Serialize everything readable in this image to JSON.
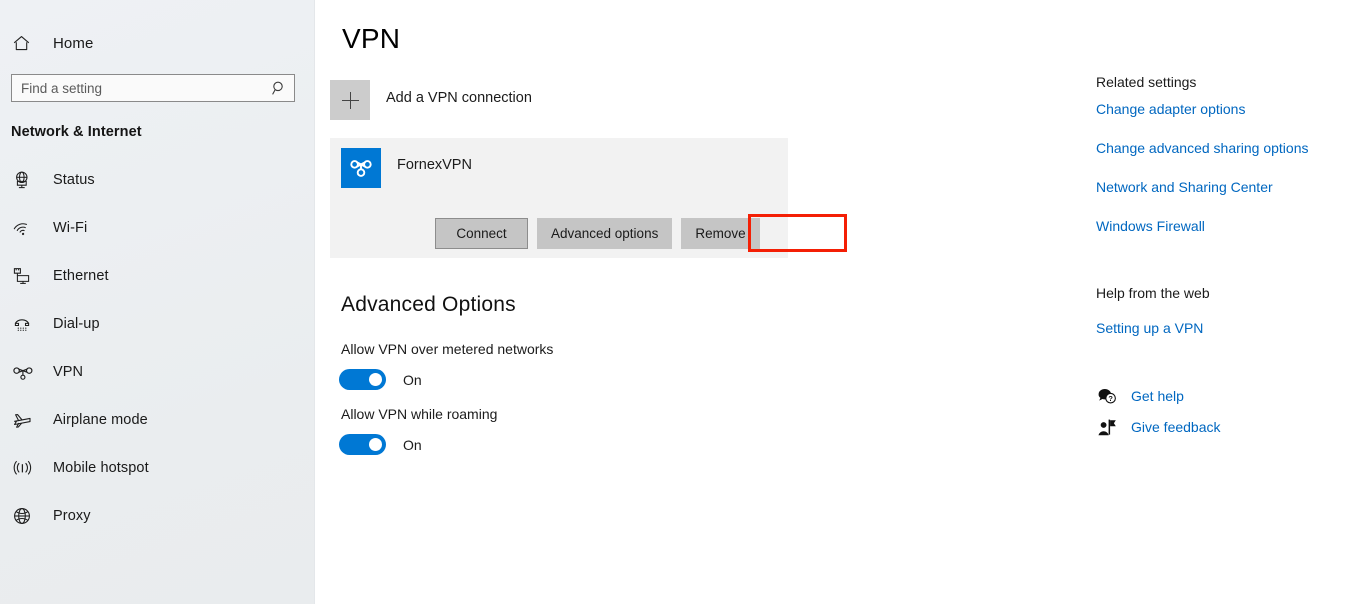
{
  "sidebar": {
    "home": {
      "label": "Home",
      "icon": "home-icon"
    },
    "search": {
      "value": "",
      "placeholder": "Find a setting",
      "icon": "search-icon"
    },
    "category": "Network & Internet",
    "items": [
      {
        "label": "Status",
        "icon": "globe-monitor-icon"
      },
      {
        "label": "Wi-Fi",
        "icon": "wifi-icon"
      },
      {
        "label": "Ethernet",
        "icon": "ethernet-icon"
      },
      {
        "label": "Dial-up",
        "icon": "dialup-phone-icon"
      },
      {
        "label": "VPN",
        "icon": "vpn-icon"
      },
      {
        "label": "Airplane mode",
        "icon": "airplane-icon"
      },
      {
        "label": "Mobile hotspot",
        "icon": "hotspot-icon"
      },
      {
        "label": "Proxy",
        "icon": "globe-icon"
      }
    ]
  },
  "main": {
    "title": "VPN",
    "add_connection": {
      "label": "Add a VPN connection",
      "icon": "plus-icon"
    },
    "connection": {
      "name": "FornexVPN",
      "icon": "vpn-knot-icon",
      "icon_color": "#0078d4",
      "buttons": [
        {
          "label": "Connect",
          "name": "connect-button",
          "highlighted": true
        },
        {
          "label": "Advanced options",
          "name": "advanced-options-button",
          "highlighted": false
        },
        {
          "label": "Remove",
          "name": "remove-button",
          "highlighted": false
        }
      ]
    },
    "advanced": {
      "title": "Advanced Options",
      "options": [
        {
          "label": "Allow VPN over metered networks",
          "state": "On",
          "on": true
        },
        {
          "label": "Allow VPN while roaming",
          "state": "On",
          "on": true
        }
      ]
    },
    "highlight_color": "#f41f05"
  },
  "right_panel": {
    "related_settings_heading": "Related settings",
    "related_links": [
      "Change adapter options",
      "Change advanced sharing options",
      "Network and Sharing Center",
      "Windows Firewall"
    ],
    "help_heading": "Help from the web",
    "help_links": [
      "Setting up a VPN"
    ],
    "support_items": [
      {
        "label": "Get help",
        "icon": "help-bubble-icon"
      },
      {
        "label": "Give feedback",
        "icon": "feedback-person-icon"
      }
    ],
    "link_color": "#0067c0"
  }
}
